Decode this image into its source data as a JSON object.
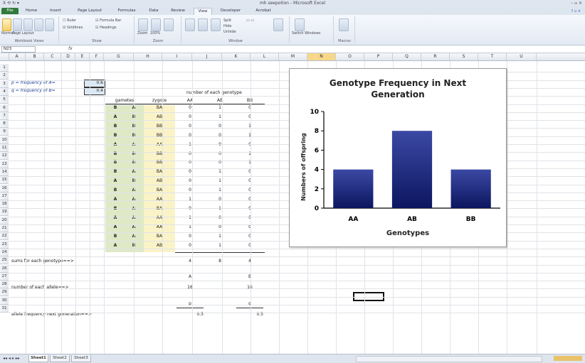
{
  "window": {
    "title": "mh seepotion - Microsoft Excel",
    "quick_access": "X ⟲ ↻ ▾"
  },
  "tabs": [
    {
      "label": "File",
      "kind": "file"
    },
    {
      "label": "Home"
    },
    {
      "label": "Insert"
    },
    {
      "label": "Page Layout"
    },
    {
      "label": "Formulas"
    },
    {
      "label": "Data"
    },
    {
      "label": "Review"
    },
    {
      "label": "View",
      "active": true
    },
    {
      "label": "Developer"
    },
    {
      "label": "Acrobat"
    }
  ],
  "ribbon": {
    "groups": [
      "Workbook Views",
      "Show",
      "Zoom",
      "Window",
      "Macros"
    ],
    "buttons": [
      "Normal",
      "Page Layout",
      "Page Break Preview",
      "Custom Views",
      "Full Screen",
      "Ruler",
      "Gridlines",
      "Formula Bar",
      "Headings",
      "Zoom",
      "100%",
      "Zoom to Selection",
      "New Window",
      "Arrange All",
      "Freeze Panes",
      "Split",
      "Hide",
      "Unhide",
      "Save Workspace",
      "Switch Windows",
      "Macros"
    ]
  },
  "formula_bar": {
    "name_box": "N23",
    "fx": "fx"
  },
  "columns": [
    "A",
    "B",
    "C",
    "D",
    "E",
    "F",
    "G",
    "H",
    "I",
    "J",
    "K",
    "L",
    "M",
    "N",
    "O",
    "P",
    "Q",
    "R",
    "S",
    "T",
    "U"
  ],
  "selected_column": "N",
  "rows": [
    "1",
    "2",
    "3",
    "4",
    "5",
    "6",
    "7",
    "8",
    "9",
    "10",
    "11",
    "12",
    "13",
    "14",
    "15",
    "16",
    "17",
    "18",
    "19",
    "20",
    "21",
    "22",
    "23",
    "24",
    "25",
    "26",
    "27",
    "28",
    "29",
    "30",
    "31"
  ],
  "sheet": {
    "p_label": "p = frequency of  A=",
    "q_label": "q = frequency of  B=",
    "p_value": "0.6",
    "q_value": "0.4",
    "number_of_each_genotype": "number of each genotype",
    "gametes_header": "gametes",
    "zygote_header": "zygote",
    "genotype_headers": [
      "AA",
      "AB",
      "BB"
    ],
    "table_rows": [
      [
        "B",
        "A",
        "BA",
        "0",
        "1",
        "0"
      ],
      [
        "A",
        "B",
        "AB",
        "0",
        "1",
        "0"
      ],
      [
        "B",
        "B",
        "BB",
        "0",
        "0",
        "1"
      ],
      [
        "B",
        "B",
        "BB",
        "0",
        "0",
        "1"
      ],
      [
        "A",
        "A",
        "AA",
        "1",
        "0",
        "0"
      ],
      [
        "B",
        "B",
        "BB",
        "0",
        "0",
        "1"
      ],
      [
        "B",
        "B",
        "BB",
        "0",
        "0",
        "1"
      ],
      [
        "B",
        "A",
        "BA",
        "0",
        "1",
        "0"
      ],
      [
        "A",
        "B",
        "AB",
        "0",
        "1",
        "0"
      ],
      [
        "B",
        "A",
        "BA",
        "0",
        "1",
        "0"
      ],
      [
        "A",
        "A",
        "AA",
        "1",
        "0",
        "0"
      ],
      [
        "B",
        "A",
        "BA",
        "0",
        "1",
        "0"
      ],
      [
        "A",
        "A",
        "AA",
        "1",
        "0",
        "0"
      ],
      [
        "A",
        "A",
        "AA",
        "1",
        "0",
        "0"
      ],
      [
        "B",
        "A",
        "BA",
        "0",
        "1",
        "0"
      ],
      [
        "A",
        "B",
        "AB",
        "0",
        "1",
        "0"
      ]
    ],
    "sums_label": "sums for each genotype==>",
    "sums": [
      "4",
      "8",
      "4"
    ],
    "allele_A_header": "A",
    "allele_B_header": "B",
    "allele_label": "number of each allele==>",
    "allele_A_count": "16",
    "allele_B_count": "16",
    "p_header": "p",
    "q_header": "q",
    "freq_label": "allele frequency next generation==>",
    "p_next": "0.5",
    "q_next": "0.5"
  },
  "chart_data": {
    "type": "bar",
    "title": "Genotype Frequency in Next Generation",
    "title_lines": [
      "Genotype Frequency in Next",
      "Generation"
    ],
    "xlabel": "Genotypes",
    "ylabel": "Numbers of offspring",
    "categories": [
      "AA",
      "AB",
      "BB"
    ],
    "values": [
      4,
      8,
      4
    ],
    "ylim": [
      0,
      10
    ],
    "yticks": [
      "0",
      "2",
      "4",
      "6",
      "8",
      "10"
    ],
    "grid": false,
    "legend": "none",
    "bar_color_top": "#3b49a3",
    "bar_color_bottom": "#0c1660"
  },
  "sheet_tabs": [
    "Sheet1",
    "Sheet2",
    "Sheet3"
  ],
  "colors": {
    "green_fill": "#dfe9c6",
    "yellow_fill": "#fbf3c8",
    "input_fill": "#dde8f5",
    "label_blue": "#1f3b99",
    "file_tab": "#2f7a3a"
  }
}
